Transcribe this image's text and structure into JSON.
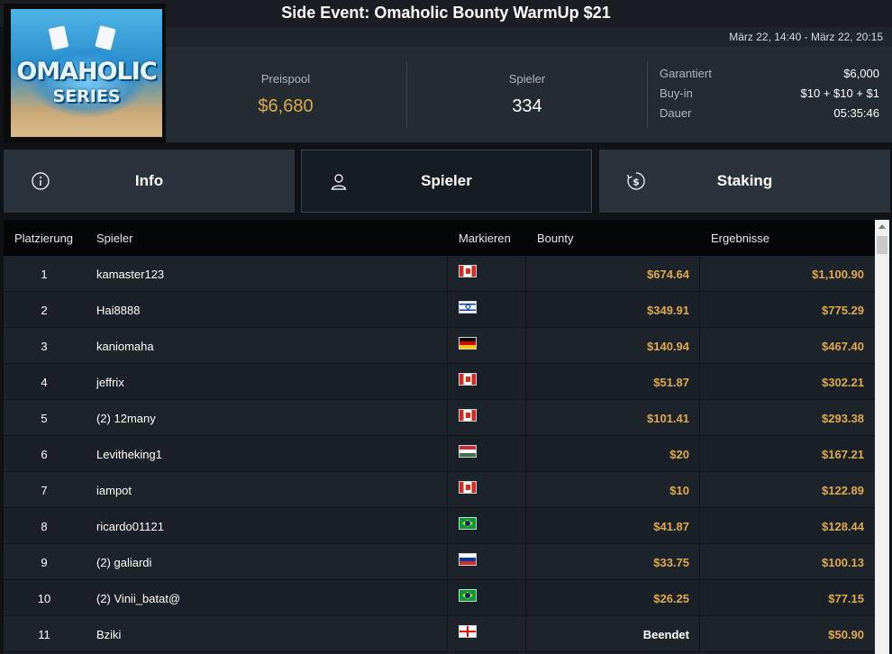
{
  "header": {
    "title": "Side Event: Omaholic Bounty WarmUp $21",
    "date_range": "März 22, 14:40 - März 22, 20:15"
  },
  "logo": {
    "line1": "OMAHOLIC",
    "line2": "SERIES"
  },
  "stats": {
    "prizepool_label": "Preispool",
    "prizepool_value": "$6,680",
    "players_label": "Spieler",
    "players_value": "334",
    "details": [
      {
        "label": "Garantiert",
        "value": "$6,000"
      },
      {
        "label": "Buy-in",
        "value": "$10 + $10 + $1"
      },
      {
        "label": "Dauer",
        "value": "05:35:46"
      }
    ]
  },
  "tabs": [
    {
      "label": "Info",
      "icon": "info-icon"
    },
    {
      "label": "Spieler",
      "icon": "user-icon"
    },
    {
      "label": "Staking",
      "icon": "dollar-cycle-icon"
    }
  ],
  "colors": {
    "accent_gold": "#e0a94a",
    "active_tab": "#161c23"
  },
  "table": {
    "headers": {
      "rank": "Platzierung",
      "player": "Spieler",
      "flag": "Markieren",
      "bounty": "Bounty",
      "result": "Ergebnisse"
    },
    "rows": [
      {
        "rank": "1",
        "player": "kamaster123",
        "flag": "canada",
        "bounty": "$674.64",
        "result": "$1,100.90"
      },
      {
        "rank": "2",
        "player": "Hai8888",
        "flag": "israel",
        "bounty": "$349.91",
        "result": "$775.29"
      },
      {
        "rank": "3",
        "player": "kaniomaha",
        "flag": "germany",
        "bounty": "$140.94",
        "result": "$467.40"
      },
      {
        "rank": "4",
        "player": "jeffrix",
        "flag": "canada",
        "bounty": "$51.87",
        "result": "$302.21"
      },
      {
        "rank": "5",
        "player": "(2) 12many",
        "flag": "canada",
        "bounty": "$101.41",
        "result": "$293.38"
      },
      {
        "rank": "6",
        "player": "Levitheking1",
        "flag": "hungary",
        "bounty": "$20",
        "result": "$167.21"
      },
      {
        "rank": "7",
        "player": "iampot",
        "flag": "canada",
        "bounty": "$10",
        "result": "$122.89"
      },
      {
        "rank": "8",
        "player": "ricardo01121",
        "flag": "brazil",
        "bounty": "$41.87",
        "result": "$128.44"
      },
      {
        "rank": "9",
        "player": "(2) galiardi",
        "flag": "russia",
        "bounty": "$33.75",
        "result": "$100.13"
      },
      {
        "rank": "10",
        "player": "(2) Vinii_batat@",
        "flag": "brazil",
        "bounty": "$26.25",
        "result": "$77.15"
      },
      {
        "rank": "11",
        "player": "Bziki",
        "flag": "georgia",
        "bounty": "Beendet",
        "result": "$50.90"
      }
    ]
  }
}
